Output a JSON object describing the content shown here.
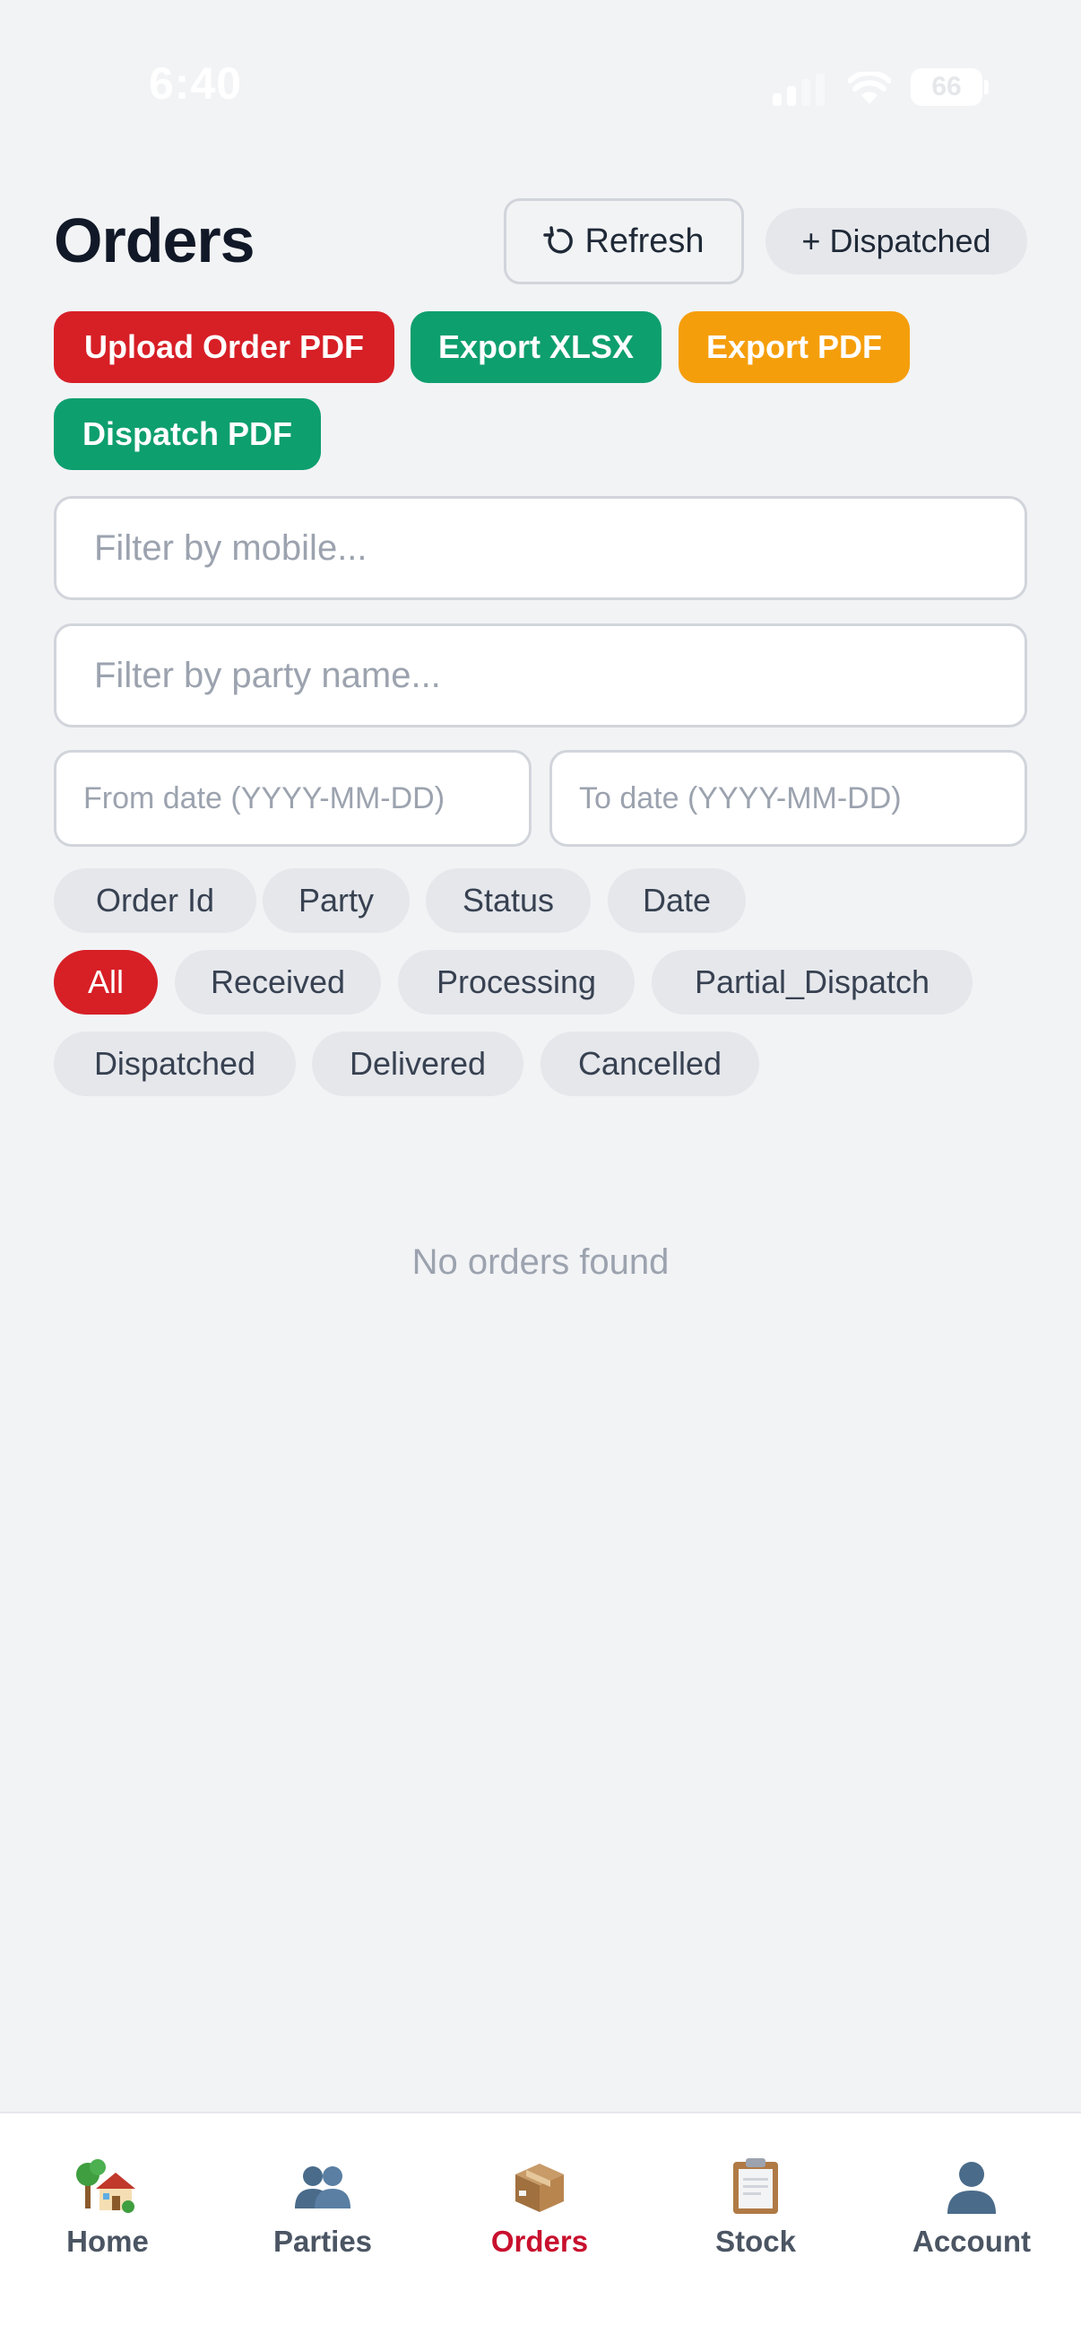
{
  "status_bar": {
    "time": "6:40",
    "battery": "66"
  },
  "header": {
    "title": "Orders",
    "refresh_label": "Refresh",
    "dispatched_label": "+ Dispatched"
  },
  "actions": {
    "upload_pdf": "Upload Order PDF",
    "export_xlsx": "Export XLSX",
    "export_pdf": "Export PDF",
    "dispatch_pdf": "Dispatch PDF"
  },
  "filters": {
    "mobile_placeholder": "Filter by mobile...",
    "party_placeholder": "Filter by party name...",
    "from_date_placeholder": "From date (YYYY-MM-DD)",
    "to_date_placeholder": "To date (YYYY-MM-DD)"
  },
  "sort_chips": [
    "Order Id",
    "Party",
    "Status",
    "Date"
  ],
  "status_chips": [
    "All",
    "Received",
    "Processing",
    "Partial_Dispatch",
    "Dispatched",
    "Delivered",
    "Cancelled"
  ],
  "active_status": "All",
  "empty_message": "No orders found",
  "bottom_nav": [
    {
      "label": "Home",
      "icon": "house-tree-icon",
      "active": false
    },
    {
      "label": "Parties",
      "icon": "people-icon",
      "active": false
    },
    {
      "label": "Orders",
      "icon": "package-icon",
      "active": true
    },
    {
      "label": "Stock",
      "icon": "clipboard-icon",
      "active": false
    },
    {
      "label": "Account",
      "icon": "person-icon",
      "active": false
    }
  ],
  "colors": {
    "brand_red": "#D71F26",
    "green": "#0E9F6E",
    "orange": "#F59E0B",
    "background": "#F2F3F5",
    "active_nav": "#C8102E"
  }
}
